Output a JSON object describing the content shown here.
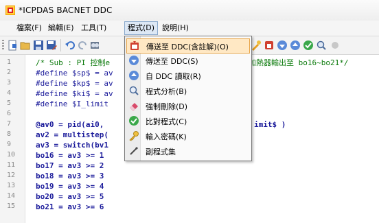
{
  "window": {
    "title": "*ICPDAS BACNET DDC"
  },
  "menubar": {
    "items": [
      {
        "label": "檔案(F)"
      },
      {
        "label": "編輯(E)"
      },
      {
        "label": "工具(T)"
      },
      {
        "label": "程式(D)"
      },
      {
        "label": "說明(H)"
      }
    ]
  },
  "toolbar": {
    "buttons": [
      "new-icon",
      "open-icon",
      "save-icon",
      "save-as-icon",
      "undo-icon",
      "redo-icon",
      "find-icon",
      "cursor-icon",
      "compile-icon",
      "send-icon",
      "download-icon",
      "upload-icon",
      "check-icon",
      "search-icon"
    ]
  },
  "dropdown": {
    "items": [
      {
        "label": "傳送至 DDC(含註解)(O)",
        "icon": "send-with-comments-icon"
      },
      {
        "label": "傳送至 DDC(S)",
        "icon": "send-to-ddc-icon"
      },
      {
        "label": "自 DDC 讀取(R)",
        "icon": "read-from-ddc-icon"
      },
      {
        "label": "程式分析(B)",
        "icon": "analyze-program-icon"
      },
      {
        "label": "強制刪除(D)",
        "icon": "force-delete-icon"
      },
      {
        "label": "比對程式(C)",
        "icon": "compare-program-icon"
      },
      {
        "label": "輸入密碼(K)",
        "icon": "password-key-icon"
      },
      {
        "label": "副程式集",
        "icon": "subroutine-set-icon"
      }
    ]
  },
  "editor": {
    "line_numbers": [
      "1",
      "2",
      "3",
      "4",
      "5",
      "6",
      "7",
      "8",
      "9",
      "10",
      "11",
      "12",
      "13",
      "14",
      "15"
    ],
    "lines": [
      "/* Sub : PI 控制e",
      "#define $sp$ = av",
      "#define $kp$ = av",
      "#define $ki$ = av",
      "#define $I_limit",
      "",
      "@av0 = pid(ai0,",
      "av2 = multistep(",
      "av3 = switch(bv1",
      "bo16 = av3 >= 1",
      "bo17 = av3 >= 2",
      "bo18 = av3 >= 3",
      "bo19 = av3 >= 4",
      "bo20 = av3 >= 5",
      "bo21 = av3 >= 6"
    ],
    "line1_tail": "加熱器輸出至 bo16~bo21*/",
    "line7_tail": "imit$ )"
  }
}
